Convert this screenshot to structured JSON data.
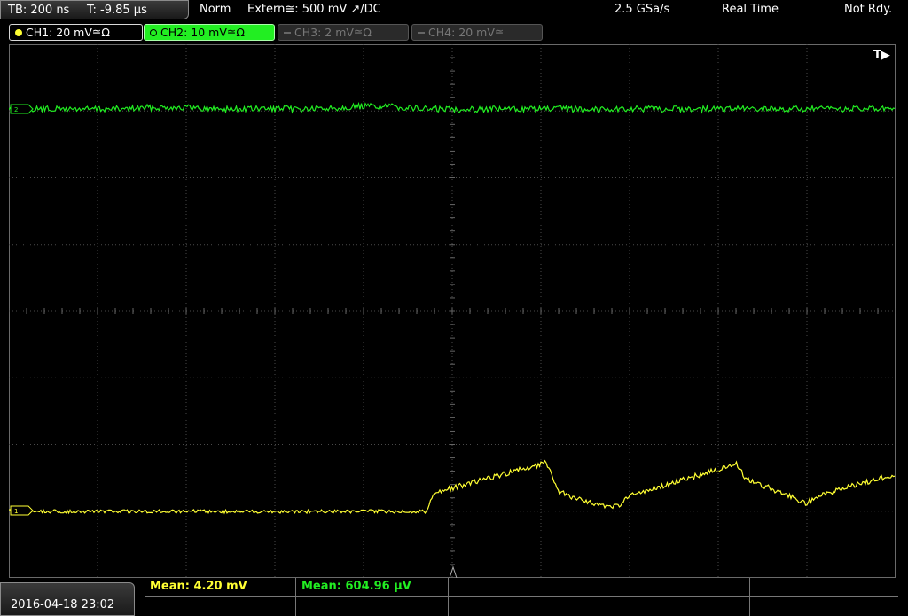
{
  "topbar": {
    "timebase": "TB: 200 ns",
    "trigger_time": "T: -9.85 µs",
    "trigger_mode": "Norm",
    "trigger_source": "Extern≅: 500 mV ↗/DC",
    "sample_rate": "2.5 GSa/s",
    "acq_mode": "Real Time",
    "status": "Not Rdy."
  },
  "channels": [
    {
      "label": "CH1: 20 mV≅Ω",
      "state": "on",
      "color": "#ffff33"
    },
    {
      "label": "CH2: 10 mV≅Ω",
      "state": "active",
      "color": "#22ee22"
    },
    {
      "label": "CH3: 2 mV≅Ω",
      "state": "off"
    },
    {
      "label": "CH4: 20 mV≅",
      "state": "off"
    }
  ],
  "trigger_marker": "T▶",
  "datetime": "2016-04-18 23:02",
  "measurements": [
    {
      "label": "Mean: 4.20 mV",
      "color": "#ffff33"
    },
    {
      "label": "Mean: 604.96 µV",
      "color": "#22ee22"
    }
  ],
  "colors": {
    "ch1": "#ffff33",
    "ch2": "#22ee22",
    "grid": "#4a4a4a",
    "background": "#000000"
  }
}
